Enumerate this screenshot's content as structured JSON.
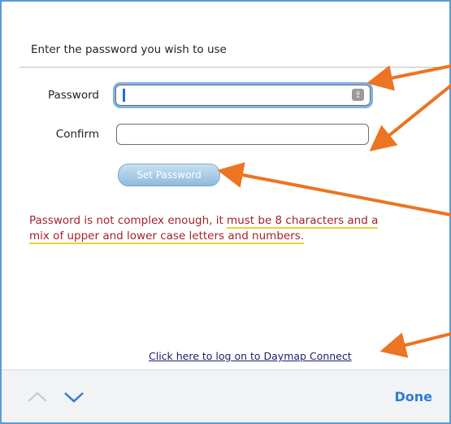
{
  "form": {
    "heading": "Enter the password you wish to use",
    "password_label": "Password",
    "confirm_label": "Confirm",
    "password_value": "",
    "confirm_value": "",
    "set_button_label": "Set Password"
  },
  "error": {
    "line1_plain": "Password is not complex enough, it ",
    "line1_highlight": "must be 8 characters and a",
    "line2_highlight": "mix of upper and lower case letters and numbers."
  },
  "link": {
    "label": "Click here to log on to Daymap Connect"
  },
  "toolbar": {
    "done_label": "Done"
  },
  "colors": {
    "accent": "#2f7bd8",
    "error_text": "#a0242a",
    "highlight_underline": "#f2cd35",
    "annotation_arrow": "#ec7422",
    "focus_ring": "#7fb2ea"
  },
  "icons": {
    "password_field": "key-icon",
    "previous": "chevron-up-icon",
    "next": "chevron-down-icon",
    "annotation": "arrow-annotation"
  }
}
